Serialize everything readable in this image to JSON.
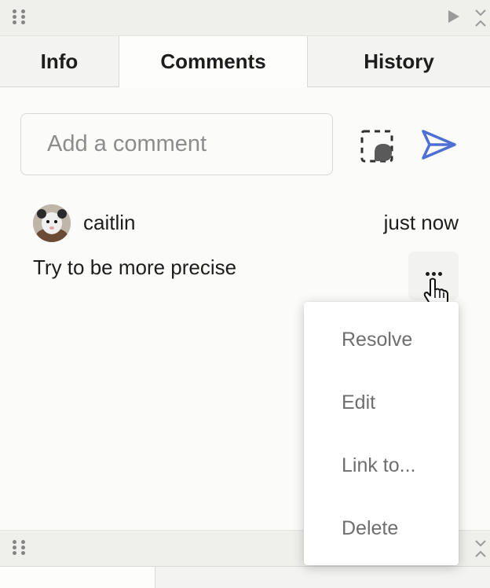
{
  "tabs": [
    {
      "label": "Info"
    },
    {
      "label": "Comments"
    },
    {
      "label": "History"
    }
  ],
  "comment_input": {
    "placeholder": "Add a comment"
  },
  "comment": {
    "author": "caitlin",
    "timestamp": "just now",
    "body": "Try to be more precise"
  },
  "menu": {
    "items": [
      "Resolve",
      "Edit",
      "Link to...",
      "Delete"
    ]
  },
  "colors": {
    "accent": "#4e6fd4",
    "panel_bar": "#efefec",
    "menu_text": "#6e6e6e"
  },
  "icons": [
    "drag-handle-icon",
    "play-icon",
    "collapse-icon",
    "attach-screenshot-icon",
    "send-icon",
    "more-icon",
    "pointer-cursor-icon"
  ]
}
